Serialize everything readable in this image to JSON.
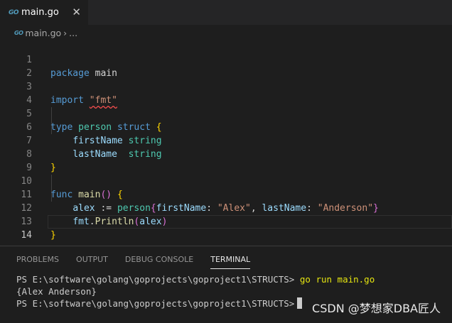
{
  "tab": {
    "icon": "go-file-icon",
    "icon_text": "GO",
    "label": "main.go",
    "close": "✕"
  },
  "breadcrumb": {
    "icon_text": "GO",
    "file": "main.go",
    "sep": "›",
    "more": "..."
  },
  "editor": {
    "line_numbers": [
      "1",
      "2",
      "3",
      "4",
      "5",
      "6",
      "7",
      "8",
      "9",
      "10",
      "11",
      "12",
      "13",
      "14"
    ],
    "l1": {
      "kw": "package",
      "name": "main"
    },
    "l3": {
      "kw": "import",
      "pkg": "\"fmt\""
    },
    "l5": {
      "kw1": "type",
      "name": "person",
      "kw2": "struct",
      "brace": "{"
    },
    "l6": {
      "field": "firstName",
      "type": "string"
    },
    "l7": {
      "field": "lastName",
      "type": "string"
    },
    "l8": {
      "brace": "}"
    },
    "l10": {
      "kw": "func",
      "name": "main",
      "parens": "()",
      "brace": "{"
    },
    "l11": {
      "var": "alex",
      "op": ":=",
      "type": "person",
      "ob": "{",
      "f1": "firstName",
      "c1": ":",
      "v1": "\"Alex\"",
      "comma": ",",
      "f2": "lastName",
      "c2": ":",
      "v2": "\"Anderson\"",
      "cb": "}"
    },
    "l12": {
      "pkg": "fmt",
      "dot": ".",
      "fn": "Println",
      "op": "(",
      "arg": "alex",
      "cp": ")"
    },
    "l13": {
      "brace": "}"
    }
  },
  "panel": {
    "tabs": [
      "PROBLEMS",
      "OUTPUT",
      "DEBUG CONSOLE",
      "TERMINAL"
    ],
    "active_tab": "TERMINAL"
  },
  "terminal": {
    "prompt": "PS E:\\software\\golang\\goprojects\\goproject1\\STRUCTS>",
    "command": "go run main.go",
    "output": "{Alex Anderson}"
  },
  "watermark": "CSDN @梦想家DBA匠人",
  "colors": {
    "keyword": "#569cd6",
    "type": "#4ec9b0",
    "function": "#dcdcaa",
    "string": "#ce9178",
    "variable": "#9cdcfe",
    "bracket": "#ffd700"
  }
}
